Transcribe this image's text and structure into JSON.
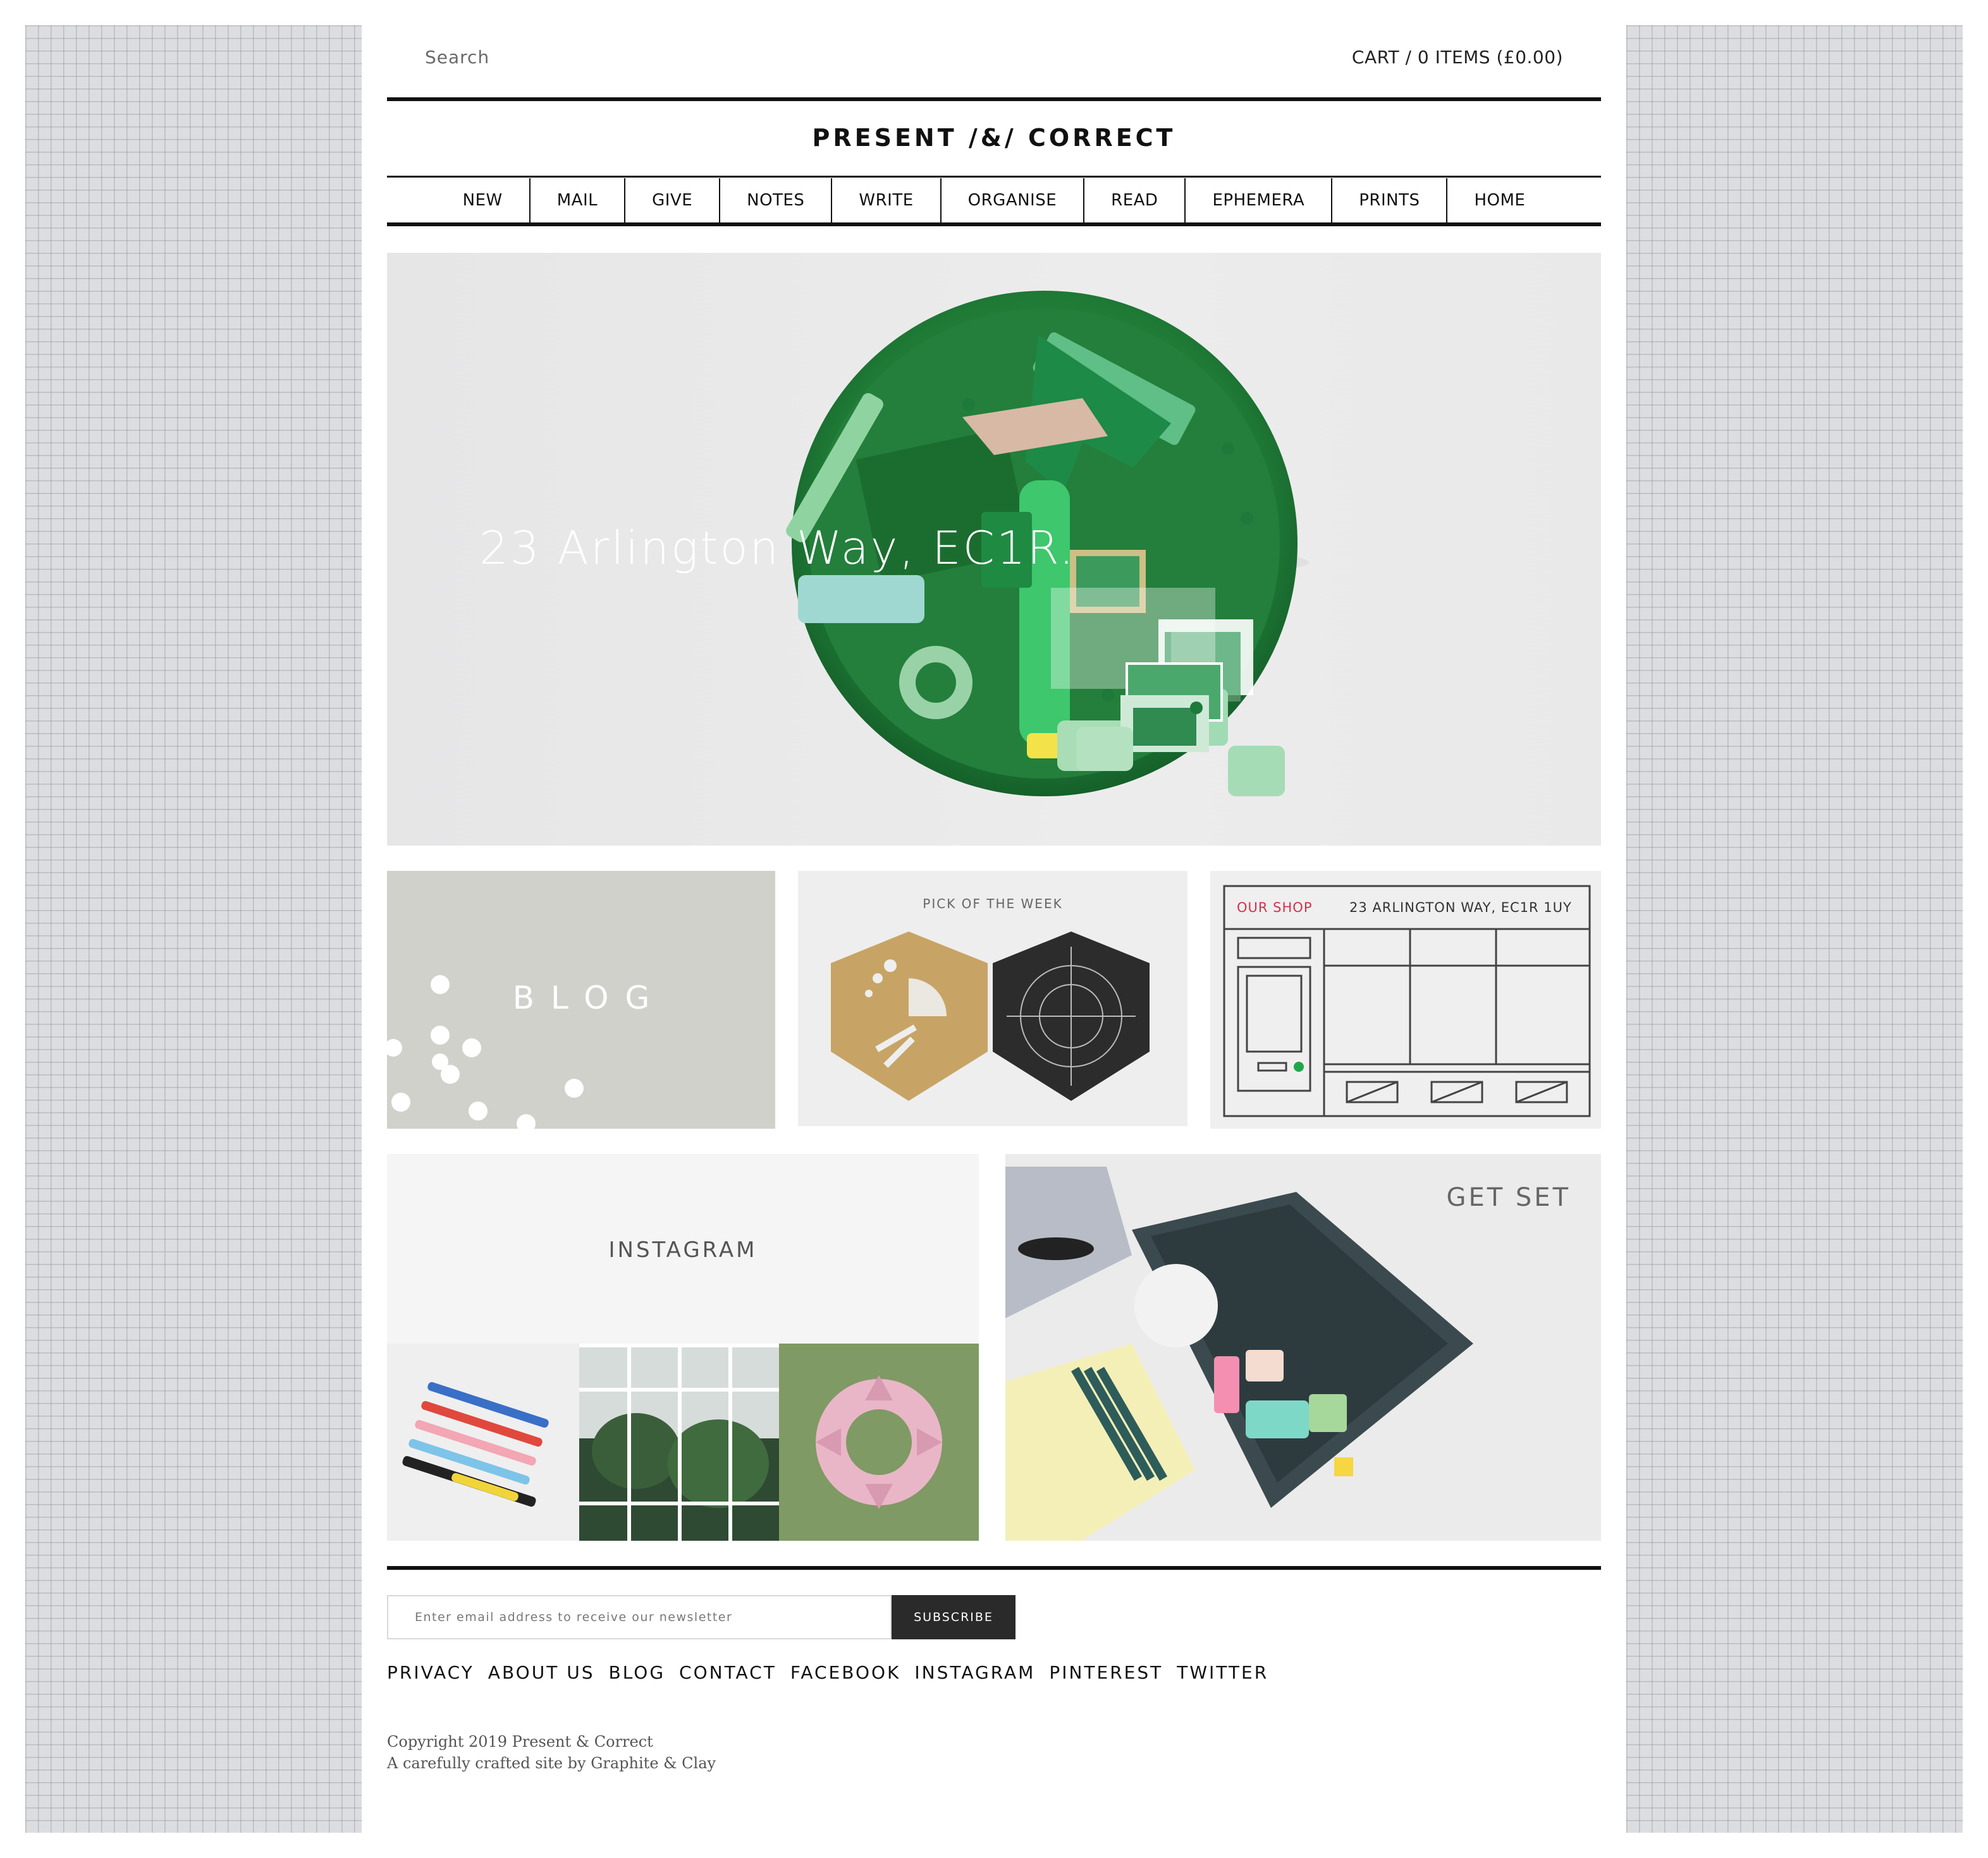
{
  "header": {
    "search_placeholder": "Search",
    "cart_label": "CART / 0 ITEMS (£0.00)",
    "logo": "PRESENT /&/ CORRECT"
  },
  "nav": {
    "items": [
      "NEW",
      "MAIL",
      "GIVE",
      "NOTES",
      "WRITE",
      "ORGANISE",
      "READ",
      "EPHEMERA",
      "PRINTS",
      "HOME"
    ]
  },
  "hero": {
    "caption": "23 Arlington Way, EC1R."
  },
  "tiles": {
    "blog": "BLOG",
    "pick": "PICK OF THE WEEK",
    "shop_label": "OUR SHOP",
    "shop_address": "23 ARLINGTON WAY, EC1R 1UY",
    "instagram": "INSTAGRAM",
    "get_set": "GET SET"
  },
  "footer": {
    "newsletter_placeholder": "Enter email address to receive our newsletter",
    "subscribe_label": "SUBSCRIBE",
    "links": [
      "PRIVACY",
      "ABOUT US",
      "BLOG",
      "CONTACT",
      "FACEBOOK",
      "INSTAGRAM",
      "PINTEREST",
      "TWITTER"
    ],
    "copyright": "Copyright 2019 Present & Correct",
    "credit": "A carefully crafted site by Graphite & Clay"
  },
  "colors": {
    "accent_red": "#d1334a",
    "tray_green": "#2c8a43",
    "button_dark": "#2a2a2a"
  }
}
